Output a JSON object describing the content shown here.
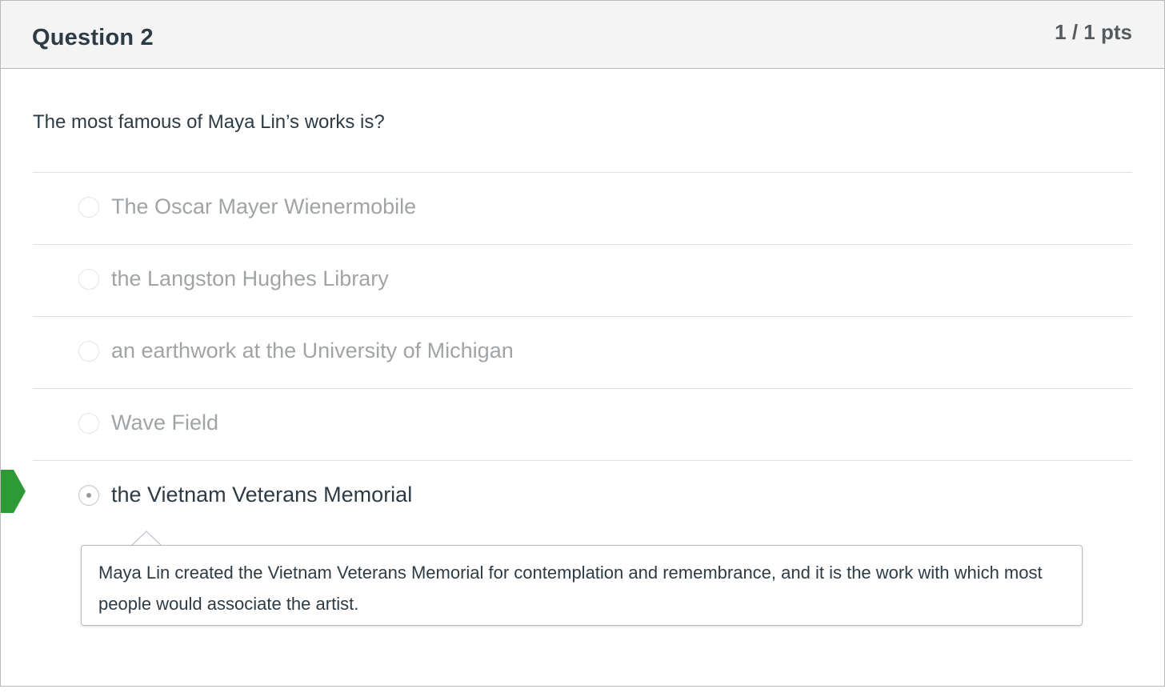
{
  "header": {
    "title": "Question 2",
    "points": "1 / 1 pts"
  },
  "question": {
    "text": "The most famous of Maya Lin’s works is?"
  },
  "answers": [
    {
      "label": "The Oscar Mayer Wienermobile",
      "selected": false
    },
    {
      "label": "the Langston Hughes Library",
      "selected": false
    },
    {
      "label": "an earthwork at the University of Michigan",
      "selected": false
    },
    {
      "label": "Wave Field",
      "selected": false
    },
    {
      "label": "the Vietnam Veterans Memorial",
      "selected": true
    }
  ],
  "feedback": {
    "text": "Maya Lin created the Vietnam Veterans Memorial for contemplation and remembrance, and it is the work with which most people would associate the artist."
  },
  "colors": {
    "correct_marker": "#2e9a36",
    "text_primary": "#2d3b45",
    "text_muted": "#a0a4a7",
    "header_bg": "#f4f4f4"
  }
}
